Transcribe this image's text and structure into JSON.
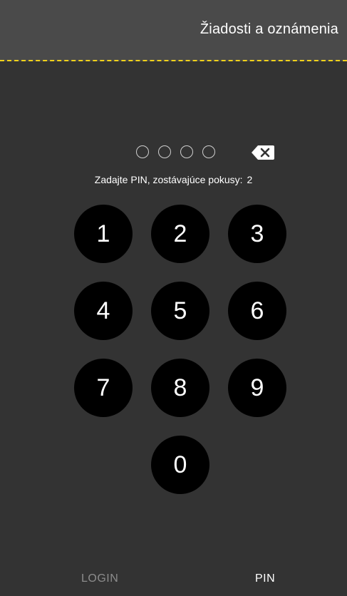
{
  "header": {
    "title": "Žiadosti a oznámenia",
    "accent_color": "#f2d21b"
  },
  "pin": {
    "entered_count": 0,
    "length": 4,
    "prompt_label": "Zadajte PIN, zostávajúce pokusy:",
    "remaining_attempts": "2",
    "backspace_icon": "backspace-icon"
  },
  "keypad": {
    "keys": [
      "1",
      "2",
      "3",
      "4",
      "5",
      "6",
      "7",
      "8",
      "9",
      "0"
    ]
  },
  "tabs": {
    "login_label": "LOGIN",
    "pin_label": "PIN",
    "active": "PIN"
  }
}
